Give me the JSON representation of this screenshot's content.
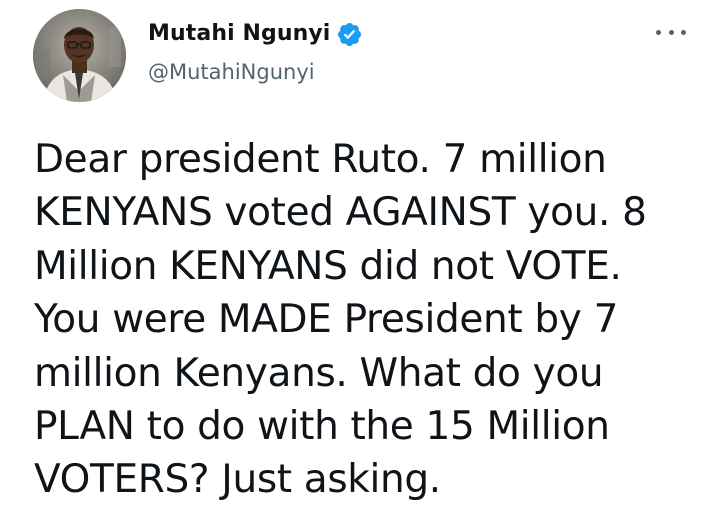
{
  "tweet": {
    "author": {
      "display_name": "Mutahi Ngunyi",
      "handle": "@MutahiNgunyi",
      "verified": true,
      "verified_color": "#1d9bf0",
      "avatar_icon": "profile-photo"
    },
    "more_icon": "more-horizontal-icon",
    "text_lines": [
      "Dear president Ruto. 7 million",
      "KENYANS voted AGAINST you. 8",
      "Million KENYANS did not VOTE.",
      "You were MADE President by 7",
      "million Kenyans. What do you",
      "PLAN to do with the 15 Million",
      "VOTERS? Just asking."
    ]
  },
  "colors": {
    "text": "#0f1419",
    "secondary": "#536471",
    "accent": "#1d9bf0"
  }
}
